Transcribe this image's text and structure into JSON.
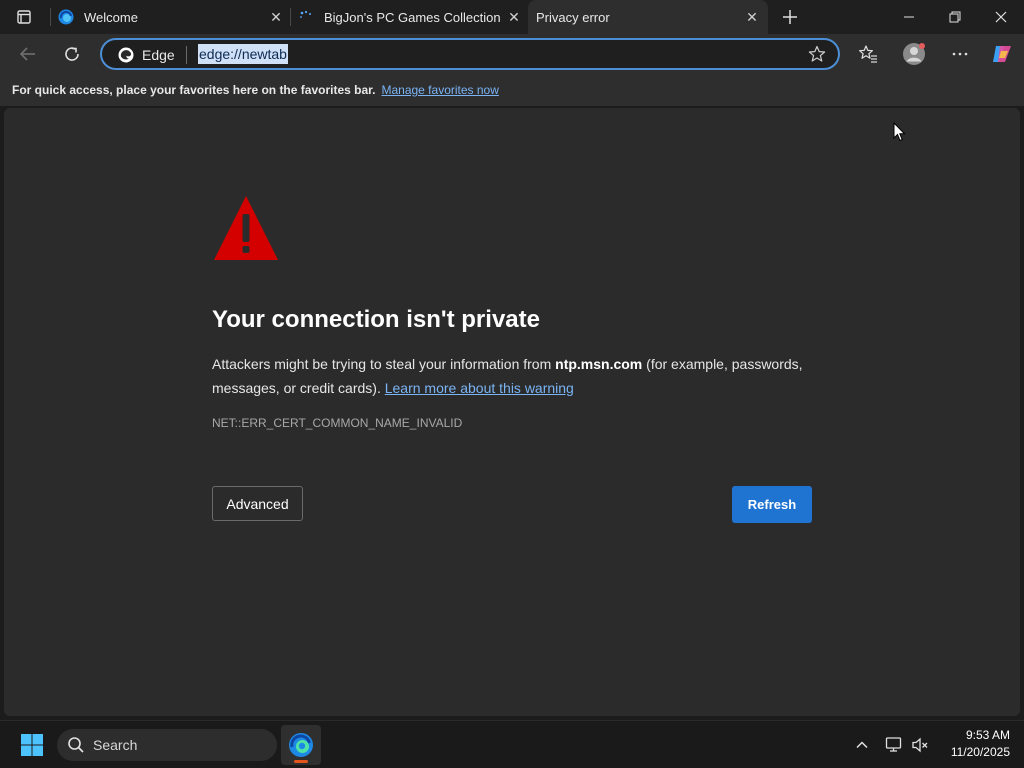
{
  "tabs": [
    {
      "title": "Welcome",
      "favicon": "edge-logo-icon",
      "active": false
    },
    {
      "title": "BigJon's PC Games Collection : Bi",
      "favicon": "loading-dots-icon",
      "active": false
    },
    {
      "title": "Privacy error",
      "favicon": "",
      "active": true
    }
  ],
  "window_controls": {
    "minimize": "minimize-icon",
    "restore": "restore-icon",
    "close": "close-icon"
  },
  "toolbar": {
    "site_label": "Edge",
    "url": "edge://newtab"
  },
  "favorites_bar": {
    "message": "For quick access, place your favorites here on the favorites bar.",
    "link": "Manage favorites now"
  },
  "error_page": {
    "heading": "Your connection isn't private",
    "text_before": "Attackers might be trying to steal your information from ",
    "host": "ntp.msn.com",
    "text_after": " (for example, passwords, messages, or credit cards). ",
    "learn_more": "Learn more about this warning",
    "error_code": "NET::ERR_CERT_COMMON_NAME_INVALID",
    "advanced_label": "Advanced",
    "refresh_label": "Refresh"
  },
  "taskbar": {
    "search_label": "Search",
    "time": "9:53 AM",
    "date": "11/20/2025"
  },
  "colors": {
    "accent": "#1f74d2",
    "link": "#7ab4f5",
    "warning_red": "#d40000"
  }
}
